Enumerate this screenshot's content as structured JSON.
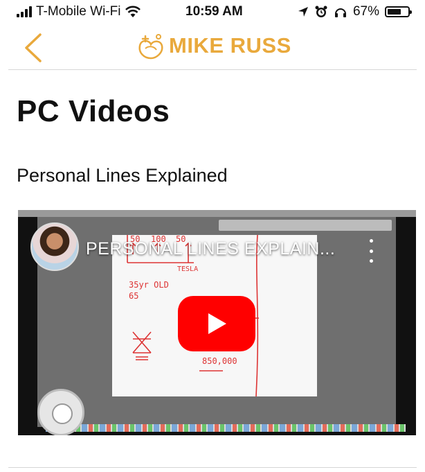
{
  "status_bar": {
    "carrier": "T-Mobile Wi-Fi",
    "time": "10:59 AM",
    "battery_percent": "67%",
    "battery_level": 0.67
  },
  "header": {
    "brand": "MIKE RUSS",
    "brand_color": "#e9a93c",
    "back_icon": "chevron-left-icon"
  },
  "page": {
    "title": "PC Videos",
    "subtitle": "Personal Lines Explained"
  },
  "video": {
    "title": "PERSONAL LINES EXPLAIN...",
    "play_color": "#ff0000",
    "whiteboard_notes": [
      "50",
      "100",
      "50",
      "TESLA",
      "35yr OLD",
      "65",
      "850,000"
    ]
  }
}
